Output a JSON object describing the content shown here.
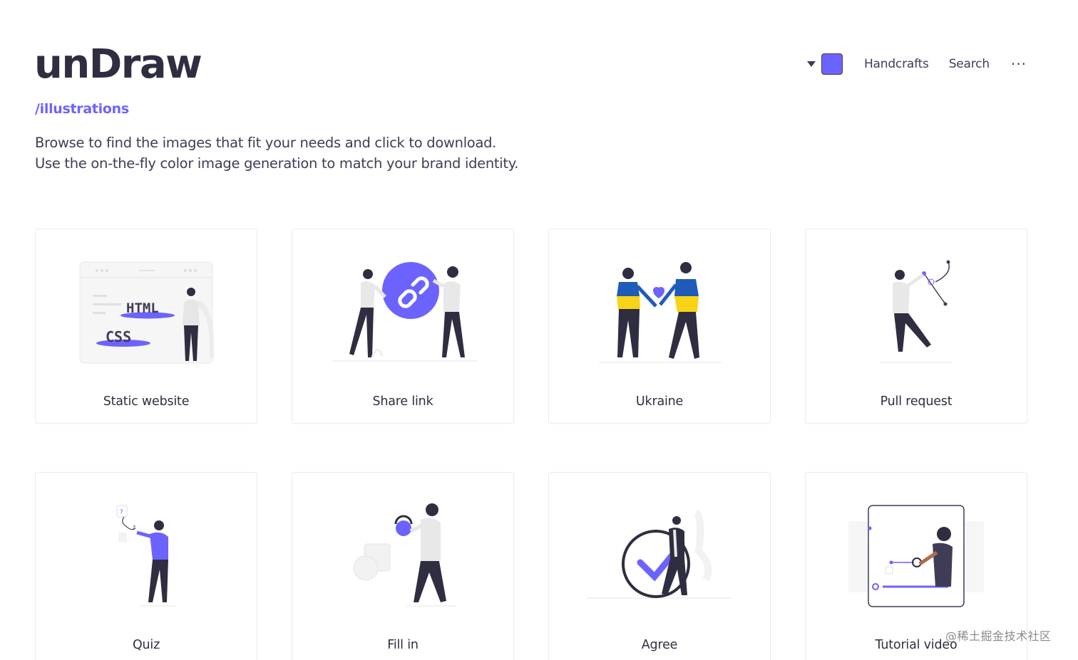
{
  "header": {
    "logo": "unDraw",
    "subtitle": "/illustrations",
    "description": "Browse to find the images that fit your needs and click to download. Use the on-the-fly color image generation to match your brand identity."
  },
  "nav": {
    "color_value": "#6c63ff",
    "handcrafts": "Handcrafts",
    "search": "Search",
    "more": "···"
  },
  "colors": {
    "accent": "#6c63ff",
    "dark": "#2f2e41",
    "ukraine_blue": "#1f5bb8",
    "ukraine_yellow": "#f7d417"
  },
  "cards": [
    {
      "label": "Static website"
    },
    {
      "label": "Share link"
    },
    {
      "label": "Ukraine"
    },
    {
      "label": "Pull request"
    },
    {
      "label": "Quiz"
    },
    {
      "label": "Fill in"
    },
    {
      "label": "Agree"
    },
    {
      "label": "Tutorial video"
    }
  ],
  "watermark": "@稀土掘金技术社区"
}
